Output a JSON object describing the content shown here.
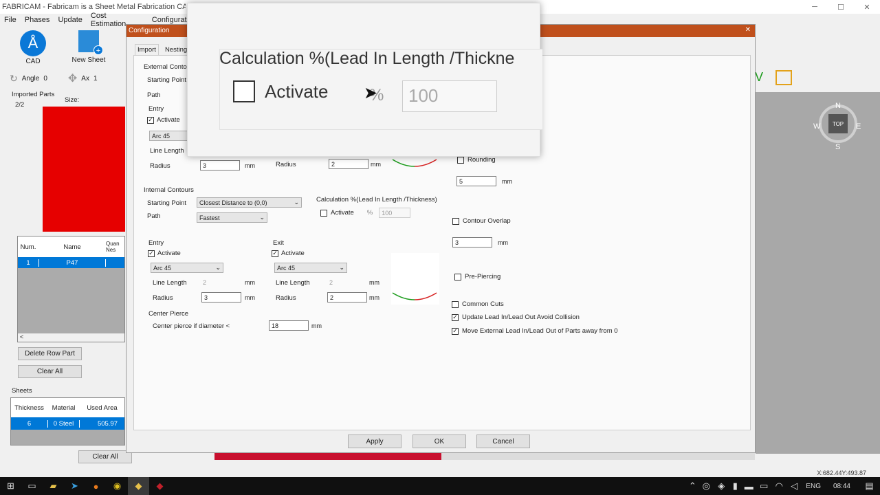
{
  "window": {
    "title": "FABRICAM - Fabricam is a Sheet Metal Fabrication CAM Softw"
  },
  "menu": {
    "file": "File",
    "phases": "Phases",
    "update": "Update",
    "cost": "Cost Estimation",
    "config": "Configurati"
  },
  "toolbar": {
    "cad": "CAD",
    "new_sheet": "New Sheet",
    "angle_label": "Angle",
    "angle_value": "0",
    "ax_label": "Ax",
    "ax_value": "1"
  },
  "parts": {
    "title": "Imported Parts",
    "count": "2/2",
    "size_label": "Size:",
    "headers": [
      "Num.",
      "Name",
      "Quan Nes"
    ],
    "rows": [
      {
        "num": "1",
        "name": "P47"
      }
    ],
    "delete_row": "Delete Row Part",
    "clear_all": "Clear All"
  },
  "sheets": {
    "title": "Sheets",
    "headers": [
      "Thickness",
      "Material",
      "Used Area"
    ],
    "row": {
      "thickness": "6",
      "material": "0  Steel",
      "used_area": "505.97"
    },
    "clear_all": "Clear All"
  },
  "dialog": {
    "title": "Configuration",
    "tabs": [
      "Import",
      "Nesting&"
    ],
    "external": {
      "title": "External Contours",
      "starting_point": "Starting Point",
      "path": "Path",
      "entry": "Entry",
      "activate": "Activate",
      "arc": "Arc 45",
      "line_length": "Line Length",
      "radius": "Radius",
      "radius_value": "3",
      "exit_radius": "2",
      "mm": "mm"
    },
    "internal": {
      "title": "Internal Contours",
      "starting_point": "Starting Point",
      "starting_value": "Closest Distance to (0,0)",
      "path": "Path",
      "path_value": "Fastest",
      "calc_title": "Calculation %(Lead In Length /Thickness)",
      "calc_activate": "Activate",
      "pct": "%",
      "pct_value": "100"
    },
    "entry": {
      "title": "Entry",
      "activate": "Activate",
      "arc": "Arc 45",
      "line_length": "Line Length",
      "line_value": "2",
      "radius": "Radius",
      "radius_value": "3",
      "mm": "mm"
    },
    "exit": {
      "title": "Exit",
      "activate": "Activate",
      "arc": "Arc 45",
      "line_length": "Line Length",
      "line_value": "2",
      "radius": "Radius",
      "radius_value": "2",
      "mm": "mm"
    },
    "center": {
      "title": "Center Pierce",
      "label": "Center pierce if diameter <",
      "value": "18",
      "mm": "mm"
    },
    "right": {
      "rounding": "Rounding",
      "rounding_value": "5",
      "contour_overlap": "Contour Overlap",
      "overlap_value": "3",
      "pre_piercing": "Pre-Piercing",
      "common_cuts": "Common Cuts",
      "update_lead": "Update Lead In/Lead Out Avoid Collision",
      "move_external": "Move External Lead In/Lead Out of Parts away from 0",
      "mm": "mm"
    },
    "buttons": {
      "apply": "Apply",
      "ok": "OK",
      "cancel": "Cancel"
    }
  },
  "zoom": {
    "title": "Calculation %(Lead In Length /Thickne",
    "activate": "Activate",
    "pct": "%",
    "value": "100"
  },
  "compass": {
    "n": "N",
    "s": "S",
    "e": "E",
    "w": "W",
    "top": "TOP"
  },
  "status": {
    "coords": "X:682.44Y:493.87"
  },
  "progress": {
    "fraction": 0.42
  },
  "taskbar": {
    "lang": "ENG",
    "time": "08:44"
  },
  "colors": {
    "accent": "#0078d7",
    "dialog_bar": "#c0501c",
    "progress": "#c8102e",
    "part": "#e60000"
  }
}
